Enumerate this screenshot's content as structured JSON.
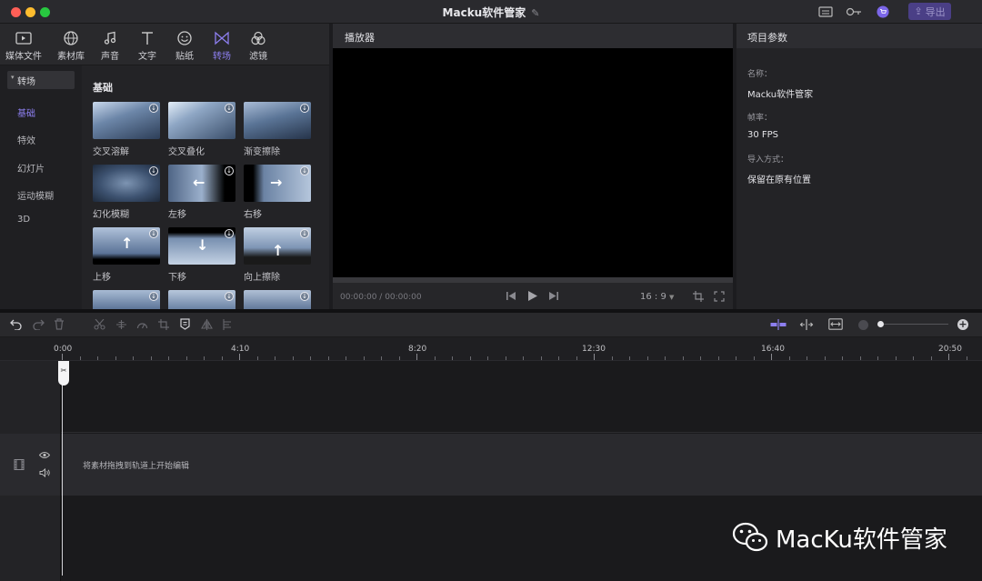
{
  "window": {
    "title": "Macku软件管家",
    "export_label": "导出",
    "traffic": {
      "close": "#ff5f57",
      "minimize": "#febc2e",
      "zoom": "#28c840"
    },
    "icons": [
      "subtitle-icon",
      "key-icon",
      "cart-icon",
      "upload-icon"
    ]
  },
  "media_tabs": [
    {
      "label": "媒体文件",
      "icon": "media-icon"
    },
    {
      "label": "素材库",
      "icon": "globe-icon"
    },
    {
      "label": "声音",
      "icon": "music-icon"
    },
    {
      "label": "文字",
      "icon": "text-icon"
    },
    {
      "label": "贴纸",
      "icon": "sticker-icon"
    },
    {
      "label": "转场",
      "icon": "transition-icon",
      "active": true
    },
    {
      "label": "滤镜",
      "icon": "filter-icon"
    }
  ],
  "categories": {
    "header": "转场",
    "items": [
      "基础",
      "特效",
      "幻灯片",
      "运动模糊",
      "3D"
    ],
    "active": "基础"
  },
  "transitions": {
    "section_title": "基础",
    "items": [
      {
        "label": "交叉溶解"
      },
      {
        "label": "交叉叠化"
      },
      {
        "label": "渐变擦除"
      },
      {
        "label": "幻化模糊"
      },
      {
        "label": "左移",
        "arrow": "←"
      },
      {
        "label": "右移",
        "arrow": "→"
      },
      {
        "label": "上移",
        "arrow": "↑"
      },
      {
        "label": "下移",
        "arrow": "↓"
      },
      {
        "label": "向上擦除",
        "arrow": "↑"
      }
    ]
  },
  "player": {
    "title": "播放器",
    "current_time": "00:00:00",
    "total_time": "00:00:00",
    "ratio": "16 : 9"
  },
  "project": {
    "title": "项目参数",
    "name_label": "名称：",
    "name_value": "Macku软件管家",
    "fps_label": "帧率：",
    "fps_value": "30 FPS",
    "import_label": "导入方式：",
    "import_value": "保留在原有位置"
  },
  "timeline": {
    "ruler_labels": [
      "0:00",
      "4:10",
      "8:20",
      "12:30",
      "16:40",
      "20:50"
    ],
    "drop_hint": "将素材拖拽到轨道上开始编辑"
  },
  "watermark": {
    "text": "MacKu软件管家"
  },
  "accent": "#8d7ff0"
}
